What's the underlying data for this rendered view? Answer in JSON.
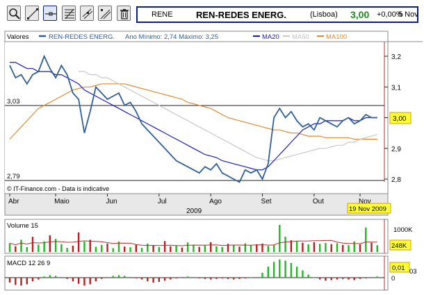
{
  "toolbar": {
    "buttons": [
      {
        "name": "zoom-button",
        "icon": "magnifier-icon"
      },
      {
        "name": "line-draw-button",
        "icon": "diagonal-line-icon"
      },
      {
        "name": "hline-button",
        "icon": "horizontal-line-icon"
      },
      {
        "name": "fibonacci-button",
        "icon": "fibonacci-icon"
      },
      {
        "name": "trend-channel-button",
        "icon": "trend-channel-icon"
      },
      {
        "name": "parallel-lines-button",
        "icon": "parallel-lines-icon"
      },
      {
        "name": "delete-button",
        "icon": "trash-icon"
      }
    ]
  },
  "quote": {
    "ticker": "RENE",
    "name": "REN-REDES ENERG.",
    "exchange": "(Lisboa)",
    "price": "3,00",
    "change": "+0,00%",
    "date": "5 Nov"
  },
  "price_panel": {
    "values_label": "Valores",
    "series_label": "REN-REDES ENERG.",
    "range_label": "Ano Mínimo: 2,74 Máximo: 3,25",
    "ma20_label": "MA20",
    "ma50_label": "MA50",
    "ma100_label": "MA100",
    "high_label": "3,03",
    "low_label": "2,79",
    "last_value_label": "3,00",
    "copyright": "© IT-Finance.com - Data is indicative",
    "y_ticks": [
      "3,2",
      "3,1",
      "3,0",
      "2,9",
      "2,8"
    ],
    "x_ticks": [
      "Abr",
      "Maio",
      "Jun",
      "Jul",
      "Ago",
      "Set",
      "Out",
      "Nov"
    ],
    "year_label": "2009",
    "date_badge": "19 Nov 2009"
  },
  "volume_panel": {
    "label": "Volume 15",
    "y_tick": "1000K",
    "last_value_label": "248K"
  },
  "macd_panel": {
    "label": "MACD 12 26 9",
    "y_tick": "0",
    "last_value_label": "0,01",
    "overflow_label": "03"
  },
  "colors": {
    "price": "#2f5f93",
    "ma20": "#1b1bb8",
    "ma50": "#c8c8c8",
    "ma100": "#e08a2e",
    "volume_up": "#1fb81f",
    "volume_down": "#b81f1f",
    "badge": "#ffff33",
    "toolbar_border": "#0a1e84"
  },
  "chart_data": [
    {
      "type": "line",
      "title": "REN-REDES ENERG.",
      "y_range": [
        2.76,
        3.25
      ],
      "x": [
        "Abr",
        "",
        "",
        "",
        "",
        "",
        "",
        "",
        "Maio",
        "",
        "",
        "",
        "",
        "",
        "",
        "",
        "",
        "Jun",
        "",
        "",
        "",
        "",
        "",
        "",
        "",
        "",
        "Jul",
        "",
        "",
        "",
        "",
        "",
        "",
        "",
        "",
        "Ago",
        "",
        "",
        "",
        "",
        "",
        "",
        "",
        "",
        "Set",
        "",
        "",
        "",
        "",
        "",
        "",
        "",
        "",
        "Out",
        "",
        "",
        "",
        "",
        "",
        "",
        "",
        "Nov"
      ],
      "series": [
        {
          "name": "REN-REDES ENERG.",
          "values": [
            3.17,
            3.13,
            3.14,
            3.11,
            3.14,
            3.15,
            3.2,
            3.16,
            3.13,
            3.17,
            3.14,
            3.08,
            3.06,
            2.95,
            3.02,
            3.1,
            3.08,
            3.06,
            3.07,
            3.08,
            3.04,
            3.05,
            3.02,
            2.98,
            2.96,
            2.94,
            2.92,
            2.9,
            2.88,
            2.86,
            2.85,
            2.84,
            2.83,
            2.82,
            2.84,
            2.83,
            2.85,
            2.82,
            2.81,
            2.8,
            2.79,
            2.83,
            2.82,
            2.83,
            2.8,
            2.85,
            3.0,
            3.03,
            3.0,
            3.02,
            2.99,
            2.97,
            2.98,
            2.96,
            3.0,
            2.99,
            2.98,
            2.97,
            2.99,
            3.0,
            2.98,
            2.99,
            3.01,
            3.0,
            3.0
          ]
        },
        {
          "name": "MA20",
          "values": [
            3.18,
            3.18,
            3.17,
            3.16,
            3.16,
            3.15,
            3.15,
            3.15,
            3.14,
            3.14,
            3.13,
            3.12,
            3.11,
            3.09,
            3.08,
            3.07,
            3.06,
            3.05,
            3.04,
            3.03,
            3.02,
            3.01,
            3.0,
            2.99,
            2.98,
            2.97,
            2.96,
            2.95,
            2.94,
            2.93,
            2.92,
            2.91,
            2.9,
            2.89,
            2.88,
            2.875,
            2.87,
            2.86,
            2.855,
            2.85,
            2.845,
            2.84,
            2.835,
            2.83,
            2.83,
            2.84,
            2.86,
            2.88,
            2.9,
            2.92,
            2.94,
            2.96,
            2.97,
            2.98,
            2.98,
            2.99,
            2.99,
            2.99,
            2.99,
            3.0,
            2.99,
            2.99,
            3.0,
            3.0,
            3.0
          ]
        },
        {
          "name": "MA50",
          "values": [
            null,
            null,
            null,
            null,
            null,
            null,
            null,
            null,
            null,
            null,
            null,
            null,
            3.15,
            3.15,
            3.14,
            3.14,
            3.13,
            3.13,
            3.12,
            3.11,
            3.1,
            3.09,
            3.08,
            3.07,
            3.06,
            3.05,
            3.04,
            3.03,
            3.02,
            3.01,
            3.0,
            2.99,
            2.98,
            2.97,
            2.96,
            2.95,
            2.94,
            2.93,
            2.92,
            2.91,
            2.9,
            2.89,
            2.88,
            2.87,
            2.865,
            2.86,
            2.86,
            2.865,
            2.87,
            2.875,
            2.88,
            2.885,
            2.89,
            2.895,
            2.9,
            2.9,
            2.905,
            2.91,
            2.91,
            2.92,
            2.92,
            2.93,
            2.935,
            2.94,
            2.945
          ]
        },
        {
          "name": "MA100",
          "values": [
            2.93,
            2.95,
            2.97,
            2.99,
            3.01,
            3.03,
            3.04,
            3.05,
            3.06,
            3.07,
            3.08,
            3.09,
            3.095,
            3.1,
            3.1,
            3.105,
            3.11,
            3.11,
            3.11,
            3.11,
            3.11,
            3.105,
            3.1,
            3.095,
            3.09,
            3.085,
            3.08,
            3.075,
            3.07,
            3.065,
            3.06,
            3.05,
            3.045,
            3.04,
            3.035,
            3.03,
            3.02,
            3.01,
            3.0,
            2.995,
            2.99,
            2.985,
            2.98,
            2.975,
            2.97,
            2.965,
            2.96,
            2.96,
            2.955,
            2.95,
            2.95,
            2.945,
            2.94,
            2.94,
            2.94,
            2.935,
            2.935,
            2.935,
            2.935,
            2.935,
            2.93,
            2.93,
            2.93,
            2.93,
            2.93
          ]
        }
      ]
    },
    {
      "type": "bar",
      "title": "Volume 15",
      "y_range": [
        0,
        1150
      ],
      "values": [
        320,
        210,
        450,
        180,
        560,
        270,
        390,
        610,
        480,
        290,
        150,
        230,
        720,
        380,
        450,
        190,
        260,
        310,
        140,
        380,
        200,
        170,
        260,
        150,
        310,
        240,
        180,
        400,
        210,
        230,
        160,
        350,
        270,
        190,
        240,
        360,
        210,
        180,
        300,
        260,
        200,
        320,
        250,
        280,
        310,
        220,
        260,
        1000,
        560,
        430,
        390,
        340,
        280,
        360,
        300,
        330,
        290,
        320,
        260,
        250,
        390,
        280,
        900,
        340,
        248
      ],
      "up": [
        1,
        0,
        1,
        1,
        0,
        1,
        1,
        0,
        1,
        1,
        1,
        0,
        0,
        1,
        0,
        1,
        1,
        0,
        1,
        1,
        0,
        1,
        0,
        1,
        1,
        0,
        1,
        0,
        0,
        1,
        0,
        1,
        1,
        0,
        1,
        0,
        1,
        1,
        0,
        1,
        0,
        1,
        1,
        0,
        0,
        1,
        1,
        1,
        1,
        0,
        1,
        0,
        1,
        0,
        1,
        1,
        0,
        1,
        0,
        1,
        1,
        0,
        1,
        0,
        1
      ]
    },
    {
      "type": "bar",
      "title": "MACD 12 26 9",
      "y_range": [
        -0.03,
        0.04
      ],
      "values": [
        -0.008,
        -0.012,
        -0.013,
        -0.011,
        -0.006,
        -0.003,
        0.002,
        0.004,
        0.003,
        0.001,
        -0.002,
        -0.006,
        -0.01,
        -0.013,
        -0.011,
        -0.006,
        -0.002,
        0.001,
        0.003,
        0.004,
        0.003,
        0.001,
        -0.001,
        -0.003,
        -0.006,
        -0.008,
        -0.007,
        -0.005,
        -0.003,
        -0.001,
        0.001,
        0.002,
        0.001,
        -0.001,
        -0.002,
        -0.003,
        -0.002,
        -0.001,
        -0.002,
        -0.003,
        -0.002,
        -0.001,
        0.0,
        0.001,
        0.008,
        0.018,
        0.026,
        0.03,
        0.028,
        0.024,
        0.018,
        0.012,
        0.005,
        0.0,
        -0.003,
        -0.005,
        -0.004,
        -0.003,
        -0.002,
        -0.003,
        -0.004,
        -0.002,
        -0.001,
        0.001,
        0.002
      ]
    }
  ]
}
